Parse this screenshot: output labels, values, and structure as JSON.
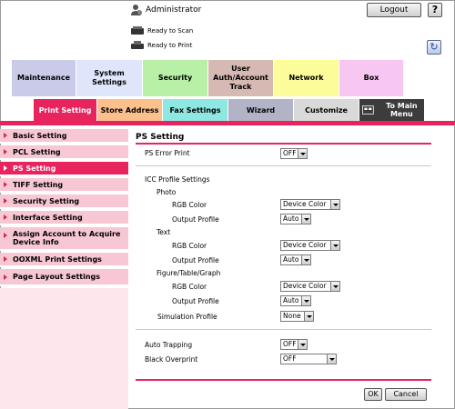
{
  "header": {
    "user": "Administrator",
    "logout": "Logout",
    "help": "?",
    "status_scan": "Ready to Scan",
    "status_print": "Ready to Print"
  },
  "category_tabs": [
    {
      "label": "Maintenance",
      "color": "#c9cbe9"
    },
    {
      "label": "System Settings",
      "color": "#dfe6fb"
    },
    {
      "label": "Security",
      "color": "#b7f0a6"
    },
    {
      "label": "User Auth/Account Track",
      "color": "#d6b9b3"
    },
    {
      "label": "Network",
      "color": "#fdfc9a"
    },
    {
      "label": "Box",
      "color": "#f7c7f2"
    }
  ],
  "sub_tabs": [
    {
      "label": "Print Setting"
    },
    {
      "label": "Store Address"
    },
    {
      "label": "Fax Settings"
    },
    {
      "label": "Wizard"
    },
    {
      "label": "Customize"
    },
    {
      "label": "To Main Menu"
    }
  ],
  "sidebar": [
    {
      "label": "Basic Setting"
    },
    {
      "label": "PCL Setting"
    },
    {
      "label": "PS Setting"
    },
    {
      "label": "TIFF Setting"
    },
    {
      "label": "Security Setting"
    },
    {
      "label": "Interface Setting"
    },
    {
      "label": "Assign Account to Acquire Device Info"
    },
    {
      "label": "OOXML Print Settings"
    },
    {
      "label": "Page Layout Settings"
    }
  ],
  "content": {
    "title": "PS Setting",
    "ps_error_print": {
      "label": "PS Error Print",
      "value": "OFF"
    },
    "icc_title": "ICC Profile Settings",
    "photo": "Photo",
    "photo_rgb": {
      "label": "RGB Color",
      "value": "Device Color"
    },
    "photo_output": {
      "label": "Output Profile",
      "value": "Auto"
    },
    "text": "Text",
    "text_rgb": {
      "label": "RGB Color",
      "value": "Device Color"
    },
    "text_output": {
      "label": "Output Profile",
      "value": "Auto"
    },
    "figure": "Figure/Table/Graph",
    "figure_rgb": {
      "label": "RGB Color",
      "value": "Device Color"
    },
    "figure_output": {
      "label": "Output Profile",
      "value": "Auto"
    },
    "simulation": {
      "label": "Simulation Profile",
      "value": "None"
    },
    "auto_trapping": {
      "label": "Auto Trapping",
      "value": "OFF"
    },
    "black_overprint": {
      "label": "Black Overprint",
      "value": "OFF"
    }
  },
  "buttons": {
    "ok": "OK",
    "cancel": "Cancel"
  },
  "colors": {
    "accent": "#e8245f",
    "sidebar": "#f7c7d3"
  }
}
